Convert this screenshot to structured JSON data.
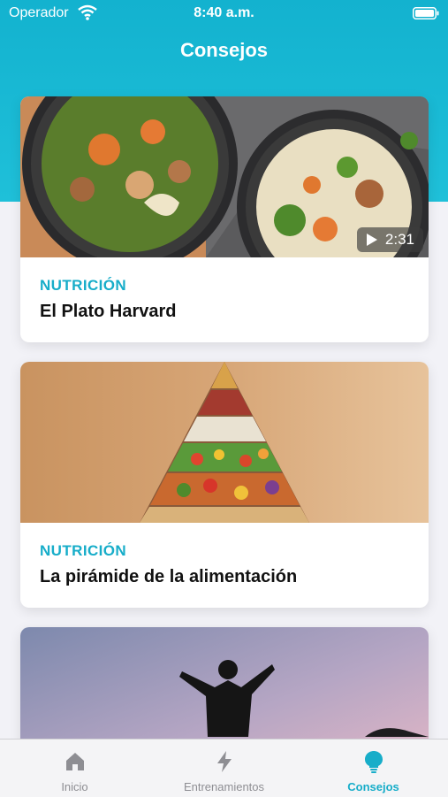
{
  "status_bar": {
    "carrier": "Operador",
    "time": "8:40 a.m."
  },
  "header": {
    "title": "Consejos"
  },
  "cards": [
    {
      "category": "NUTRICIÓN",
      "title": "El Plato Harvard",
      "image": "noodle-bowls-photo",
      "duration": "2:31"
    },
    {
      "category": "NUTRICIÓN",
      "title": "La pirámide de la alimentación",
      "image": "food-pyramid-photo"
    },
    {
      "image": "person-arms-raised-sunset-photo"
    }
  ],
  "tab_bar": {
    "items": [
      {
        "label": "Inicio",
        "icon": "home-icon",
        "active": false
      },
      {
        "label": "Entrenamientos",
        "icon": "lightning-icon",
        "active": false
      },
      {
        "label": "Consejos",
        "icon": "lightbulb-icon",
        "active": true
      }
    ]
  },
  "colors": {
    "accent": "#17adc9",
    "header": "#13b2cf",
    "inactive_tab": "#8e8e93"
  }
}
